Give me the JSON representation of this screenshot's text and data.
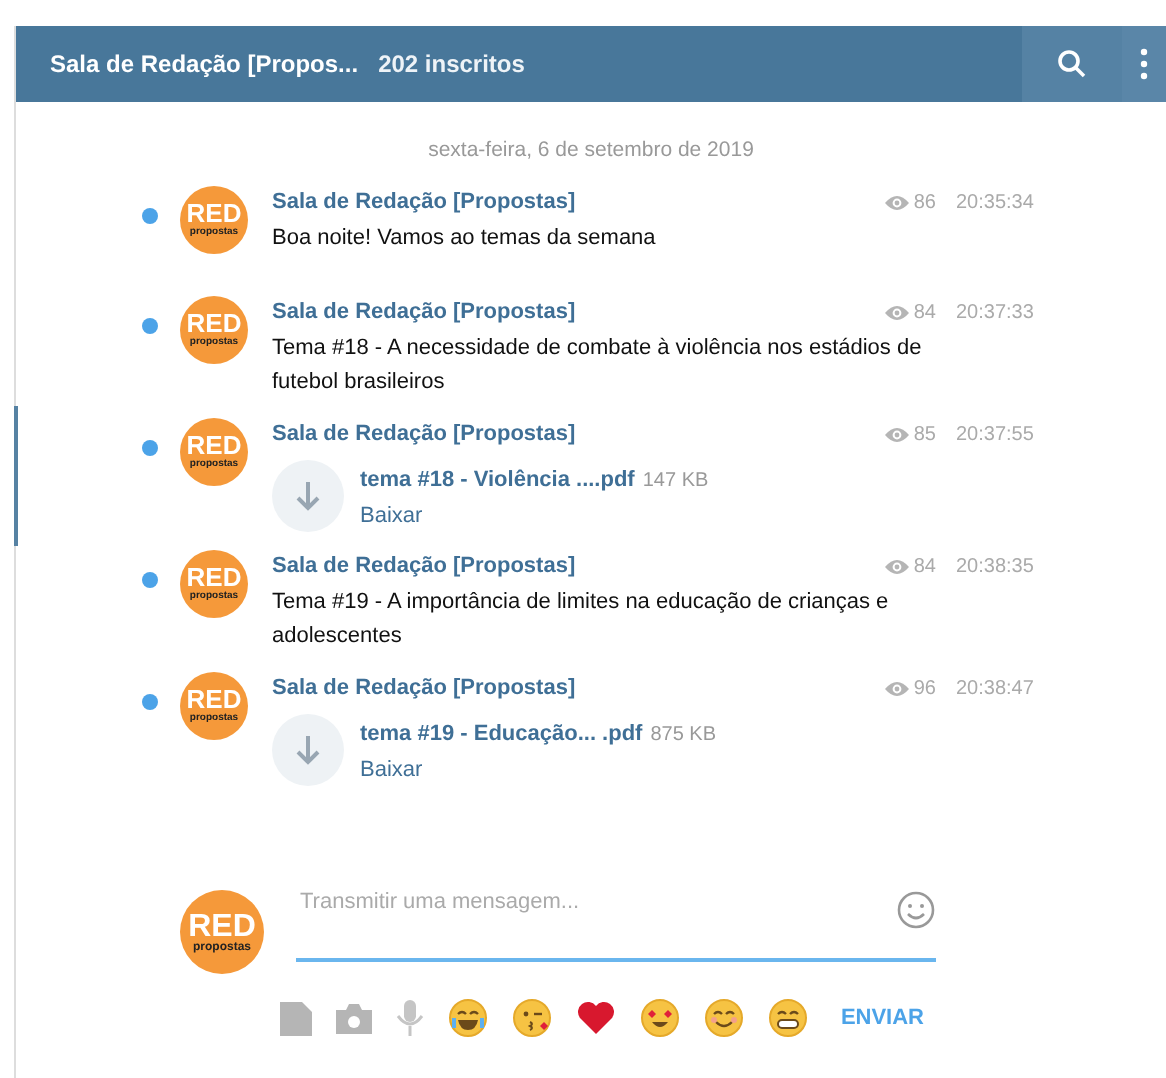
{
  "header": {
    "title": "Sala de Redação [Propos...",
    "subscribers": "202 inscritos"
  },
  "date_separator": "sexta-feira, 6 de setembro de 2019",
  "messages": [
    {
      "kind": "text",
      "sender": "Sala de Redação [Propostas]",
      "views": "86",
      "time": "20:35:34",
      "unread": true,
      "selected": false,
      "avatar": {
        "logo": "RED",
        "tagline": "propostas"
      },
      "text": "Boa noite! Vamos ao temas da semana"
    },
    {
      "kind": "text",
      "sender": "Sala de Redação [Propostas]",
      "views": "84",
      "time": "20:37:33",
      "unread": true,
      "selected": false,
      "avatar": {
        "logo": "RED",
        "tagline": "propostas"
      },
      "text": "Tema #18 - A necessidade de combate à violência nos estádios de futebol brasileiros"
    },
    {
      "kind": "file",
      "sender": "Sala de Redação [Propostas]",
      "views": "85",
      "time": "20:37:55",
      "unread": true,
      "selected": true,
      "avatar": {
        "logo": "RED",
        "tagline": "propostas"
      },
      "file_name": "tema #18 - Violência ....pdf",
      "file_size": "147 KB",
      "action": "Baixar"
    },
    {
      "kind": "text",
      "sender": "Sala de Redação [Propostas]",
      "views": "84",
      "time": "20:38:35",
      "unread": true,
      "selected": false,
      "avatar": {
        "logo": "RED",
        "tagline": "propostas"
      },
      "text": "Tema #19 - A importância de limites na educação de crianças e adolescentes"
    },
    {
      "kind": "file",
      "sender": "Sala de Redação [Propostas]",
      "views": "96",
      "time": "20:38:47",
      "unread": true,
      "selected": false,
      "avatar": {
        "logo": "RED",
        "tagline": "propostas"
      },
      "file_name": "tema #19 - Educação... .pdf",
      "file_size": "875 KB",
      "action": "Baixar"
    }
  ],
  "composer": {
    "avatar": {
      "logo": "RED",
      "tagline": "propostas"
    },
    "placeholder": "Transmitir uma mensagem...",
    "send": "ENVIAR"
  }
}
